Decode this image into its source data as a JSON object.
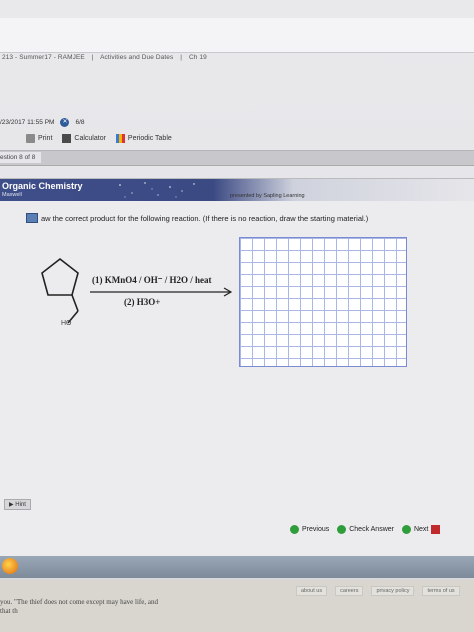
{
  "breadcrumb": {
    "course": "213 - Summer17 - RAMJEE",
    "link1": "Activities and Due Dates",
    "link2": "Ch 19"
  },
  "assignment": {
    "due": "/23/2017 11:55 PM",
    "score": "6/8"
  },
  "tools": {
    "print": "Print",
    "calculator": "Calculator",
    "periodic_table": "Periodic Table"
  },
  "question_nav": "estion 8 of 8",
  "banner": {
    "title": "Organic Chemistry",
    "author": "Maxwell",
    "presented": "presented by Sapling Learning"
  },
  "prompt": "aw the correct product for the following reaction. (If there is no reaction, draw the starting material.)",
  "molecule": {
    "group_label": "HO"
  },
  "reaction": {
    "step1": "(1) KMnO4 / OH⁻ / H2O / heat",
    "step2": "(2) H3O+"
  },
  "hint": "Hint",
  "nav": {
    "previous": "Previous",
    "check": "Check Answer",
    "next": "Next"
  },
  "footer": {
    "about": "about us",
    "careers": "careers",
    "privacy": "privacy policy",
    "terms": "terms of us"
  },
  "note": "you. \"The thief does not come except\n may have life, and that th"
}
